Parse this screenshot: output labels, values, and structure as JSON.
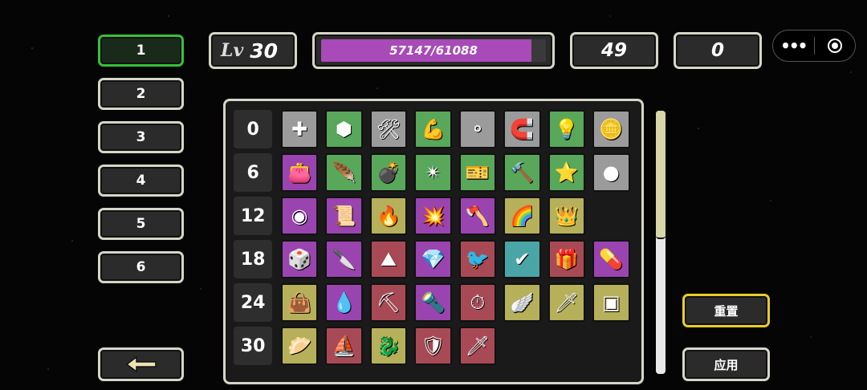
{
  "slots": [
    {
      "label": "1",
      "active": true
    },
    {
      "label": "2",
      "active": false
    },
    {
      "label": "3",
      "active": false
    },
    {
      "label": "4",
      "active": false
    },
    {
      "label": "5",
      "active": false
    },
    {
      "label": "6",
      "active": false
    }
  ],
  "level": {
    "label": "Lv",
    "value": "30"
  },
  "xp": {
    "text": "57147/61088",
    "current": 57147,
    "max": 61088,
    "color": "#a84ab8"
  },
  "stat_a": "49",
  "stat_b": "0",
  "buttons": {
    "reset": "重置",
    "apply": "应用",
    "back_icon": "left-arrow-icon"
  },
  "colors": {
    "green": "#58a75a",
    "gray": "#9b9b9b",
    "purple": "#9a44b0",
    "olive": "#b6b05a",
    "red": "#a84a55",
    "teal": "#4aa6a6",
    "brown": "#a76e50",
    "active_border": "#36c13a",
    "reset_border": "#e6cc29"
  },
  "grid": [
    {
      "label": "0",
      "cells": [
        {
          "icon": "green-cross-plus-icon",
          "glyph": "✚",
          "bg": "gray"
        },
        {
          "icon": "turtle-shell-icon",
          "glyph": "⬢",
          "bg": "green"
        },
        {
          "icon": "tool-bag-icon",
          "glyph": "🛠",
          "bg": "gray"
        },
        {
          "icon": "flexed-arm-icon",
          "glyph": "💪",
          "bg": "green"
        },
        {
          "icon": "coins-icon",
          "glyph": "⚬",
          "bg": "gray"
        },
        {
          "icon": "magnet-icon",
          "glyph": "🧲",
          "bg": "gray"
        },
        {
          "icon": "light-bulb-icon",
          "glyph": "💡",
          "bg": "green"
        },
        {
          "icon": "coin-stacks-icon",
          "glyph": "🪙",
          "bg": "gray"
        }
      ]
    },
    {
      "label": "6",
      "cells": [
        {
          "icon": "wallet-icon",
          "glyph": "👛",
          "bg": "purple"
        },
        {
          "icon": "feather-icon",
          "glyph": "🪶",
          "bg": "green"
        },
        {
          "icon": "bomb-icon",
          "glyph": "💣",
          "bg": "green"
        },
        {
          "icon": "shurikens-icon",
          "glyph": "✴",
          "bg": "green"
        },
        {
          "icon": "ticket-icon",
          "glyph": "🎫",
          "bg": "green"
        },
        {
          "icon": "bloody-hammer-icon",
          "glyph": "🔨",
          "bg": "green"
        },
        {
          "icon": "star-shield-icon",
          "glyph": "⭐",
          "bg": "green"
        },
        {
          "icon": "gold-coin-icon",
          "glyph": "●",
          "bg": "gray"
        }
      ]
    },
    {
      "label": "12",
      "cells": [
        {
          "icon": "dark-orb-icon",
          "glyph": "◉",
          "bg": "purple"
        },
        {
          "icon": "scroll-creature-icon",
          "glyph": "📜",
          "bg": "purple"
        },
        {
          "icon": "flaming-boots-icon",
          "glyph": "🔥",
          "bg": "olive"
        },
        {
          "icon": "exploding-card-icon",
          "glyph": "💥",
          "bg": "purple"
        },
        {
          "icon": "axe-icon",
          "glyph": "🪓",
          "bg": "purple"
        },
        {
          "icon": "rainbow-icon",
          "glyph": "🌈",
          "bg": "olive"
        },
        {
          "icon": "layered-crown-icon",
          "glyph": "👑",
          "bg": "olive"
        },
        {
          "icon": "empty",
          "glyph": "",
          "bg": "empty"
        }
      ]
    },
    {
      "label": "18",
      "cells": [
        {
          "icon": "dice-coins-icon",
          "glyph": "🎲",
          "bg": "purple"
        },
        {
          "icon": "crossed-knives-icon",
          "glyph": "🔪",
          "bg": "purple"
        },
        {
          "icon": "stone-anvil-icon",
          "glyph": "⛰",
          "bg": "red"
        },
        {
          "icon": "yellow-crystal-icon",
          "glyph": "💎",
          "bg": "purple"
        },
        {
          "icon": "bird-potion-icon",
          "glyph": "🐦",
          "bg": "red"
        },
        {
          "icon": "check-mark-icon",
          "glyph": "✔",
          "bg": "teal"
        },
        {
          "icon": "treasure-chest-icon",
          "glyph": "🎁",
          "bg": "red"
        },
        {
          "icon": "purple-pills-icon",
          "glyph": "💊",
          "bg": "purple"
        }
      ]
    },
    {
      "label": "24",
      "cells": [
        {
          "icon": "amulet-bag-icon",
          "glyph": "👜",
          "bg": "olive"
        },
        {
          "icon": "water-drop-book-icon",
          "glyph": "💧",
          "bg": "purple"
        },
        {
          "icon": "pickaxe-icon",
          "glyph": "⛏",
          "bg": "red"
        },
        {
          "icon": "torch-icon",
          "glyph": "🔦",
          "bg": "purple"
        },
        {
          "icon": "winged-clock-icon",
          "glyph": "⏱",
          "bg": "red"
        },
        {
          "icon": "wings-halo-icon",
          "glyph": "🪽",
          "bg": "olive"
        },
        {
          "icon": "blue-sword-icon",
          "glyph": "🗡",
          "bg": "olive"
        },
        {
          "icon": "square-frame-icon",
          "glyph": "▣",
          "bg": "olive"
        }
      ]
    },
    {
      "label": "30",
      "cells": [
        {
          "icon": "gold-nuggets-icon",
          "glyph": "🥟",
          "bg": "olive"
        },
        {
          "icon": "pirate-ship-icon",
          "glyph": "⛵",
          "bg": "red"
        },
        {
          "icon": "dragon-sword-icon",
          "glyph": "🐉",
          "bg": "olive"
        },
        {
          "icon": "ornate-shield-icon",
          "glyph": "🛡",
          "bg": "red"
        },
        {
          "icon": "flaming-dagger-icon",
          "glyph": "🗡",
          "bg": "red"
        },
        {
          "icon": "empty",
          "glyph": "",
          "bg": "empty"
        },
        {
          "icon": "empty",
          "glyph": "",
          "bg": "empty"
        },
        {
          "icon": "empty",
          "glyph": "",
          "bg": "empty"
        }
      ]
    }
  ]
}
